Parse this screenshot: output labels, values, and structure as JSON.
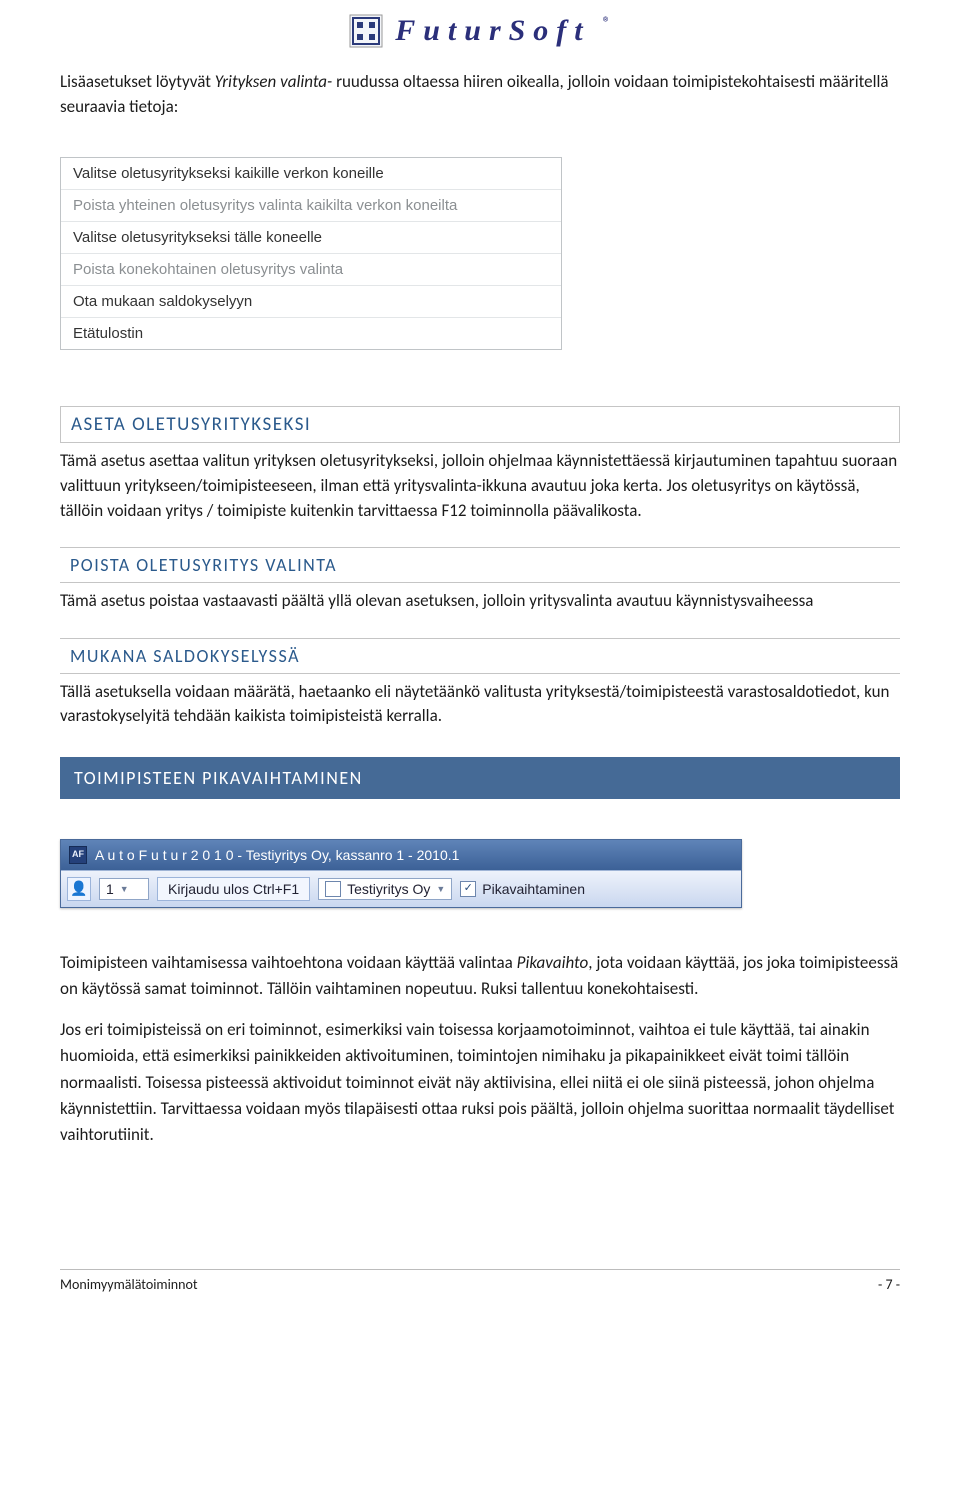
{
  "logo": {
    "text": "FuturSoft"
  },
  "intro_prefix": "Lisäasetukset löytyvät ",
  "intro_italic": "Yrityksen valinta-",
  "intro_rest": " ruudussa oltaessa hiiren oikealla, jolloin voidaan toimipistekohtaisesti määritellä seuraavia tietoja:",
  "context_menu": {
    "items": [
      {
        "label": "Valitse oletusyritykseksi kaikille verkon koneille",
        "dim": false
      },
      {
        "label": "Poista yhteinen oletusyritys valinta kaikilta verkon koneilta",
        "dim": true
      },
      {
        "label": "Valitse oletusyritykseksi tälle koneelle",
        "dim": false
      },
      {
        "label": "Poista konekohtainen oletusyritys valinta",
        "dim": true
      },
      {
        "label": "Ota mukaan saldokyselyyn",
        "dim": false
      },
      {
        "label": "Etätulostin",
        "dim": false
      }
    ]
  },
  "sections": {
    "aseta_title": "ASETA OLETUSYRITYKSEKSI",
    "aseta_body": "Tämä asetus asettaa valitun yrityksen oletusyritykseksi, jolloin ohjelmaa käynnistettäessä kirjautuminen tapahtuu suoraan valittuun yritykseen/toimipisteeseen, ilman että yritysvalinta-ikkuna avautuu joka kerta. Jos oletusyritys on käytössä, tällöin voidaan yritys / toimipiste kuitenkin tarvittaessa F12 toiminnolla päävalikosta.",
    "poista_title": "POISTA OLETUSYRITYS VALINTA",
    "poista_body": "Tämä asetus poistaa vastaavasti päältä yllä olevan asetuksen, jolloin yritysvalinta avautuu käynnistysvaiheessa",
    "mukana_title": "MUKANA SALDOKYSELYSSÄ",
    "mukana_body": "Tällä asetuksella voidaan määrätä, haetaanko eli näytetäänkö valitusta yrityksestä/toimipisteestä varastosaldotiedot, kun varastokyselyitä tehdään kaikista toimipisteistä kerralla.",
    "vaihto_title": "TOIMIPISTEEN PIKAVAIHTAMINEN"
  },
  "toolbar": {
    "title": "A u t o F u t u r  2 0 1 0 - Testiyritys Oy, kassanro 1 - 2010.1",
    "num": "1",
    "logout_label": "Kirjaudu ulos Ctrl+F1",
    "company": "Testiyritys Oy",
    "pikavaihto_label": "Pikavaihtaminen"
  },
  "body2": {
    "p1_prefix": "Toimipisteen vaihtamisessa vaihtoehtona voidaan käyttää valintaa ",
    "p1_italic": "Pikavaihto",
    "p1_rest": ", jota voidaan käyttää, jos joka toimipisteessä on käytössä samat toiminnot. Tällöin vaihtaminen nopeutuu. Ruksi tallentuu konekohtaisesti.",
    "p2": "Jos eri toimipisteissä on eri toiminnot, esimerkiksi vain toisessa korjaamotoiminnot, vaihtoa ei tule käyttää, tai ainakin huomioida, että esimerkiksi painikkeiden aktivoituminen, toimintojen nimihaku ja pikapainikkeet eivät toimi tällöin normaalisti. Toisessa pisteessä aktivoidut toiminnot eivät näy aktiivisina, ellei niitä ei ole siinä pisteessä, johon ohjelma käynnistettiin. Tarvittaessa voidaan myös tilapäisesti ottaa ruksi pois päältä, jolloin ohjelma suorittaa normaalit täydelliset vaihtorutiinit."
  },
  "footer": {
    "left": "Monimyymälätoiminnot",
    "right": "- 7 -"
  }
}
